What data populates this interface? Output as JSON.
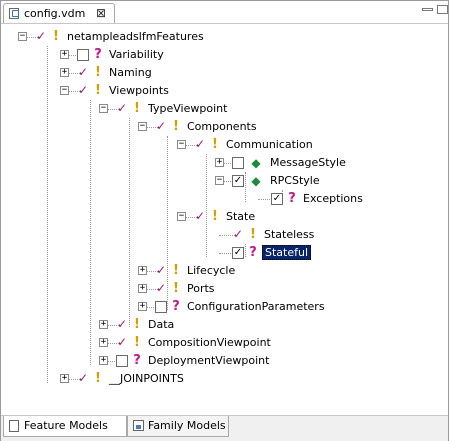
{
  "editor": {
    "tab_title": "config.vdm",
    "close_glyph": "⊠"
  },
  "colors": {
    "selected_bg": "#0a246a",
    "check_color": "#a0157a",
    "excl_color": "#d4a000",
    "quest_color": "#c01a8a",
    "diamond_color": "#1e8a3a"
  },
  "tree": [
    {
      "label": "netampleadslfmFeatures",
      "expander": "−",
      "check": "✓",
      "icon": "!",
      "icon_name": "mandatory-feature-icon"
    },
    {
      "label": "Variability",
      "expander": "+",
      "check": "",
      "icon": "?",
      "icon_name": "optional-feature-icon"
    },
    {
      "label": "Naming",
      "expander": "+",
      "check": "✓",
      "icon": "!",
      "icon_name": "mandatory-feature-icon"
    },
    {
      "label": "Viewpoints",
      "expander": "−",
      "check": "✓",
      "icon": "!",
      "icon_name": "mandatory-feature-icon"
    },
    {
      "label": "TypeViewpoint",
      "expander": "−",
      "check": "✓",
      "icon": "!",
      "icon_name": "mandatory-feature-icon"
    },
    {
      "label": "Components",
      "expander": "−",
      "check": "✓",
      "icon": "!",
      "icon_name": "mandatory-feature-icon"
    },
    {
      "label": "Communication",
      "expander": "−",
      "check": "✓",
      "icon": "!",
      "icon_name": "mandatory-feature-icon"
    },
    {
      "label": "MessageStyle",
      "expander": "+",
      "check": "",
      "icon": "◆",
      "icon_name": "alternative-group-icon"
    },
    {
      "label": "RPCStyle",
      "expander": "−",
      "check": "✓",
      "icon": "◆",
      "icon_name": "alternative-group-icon"
    },
    {
      "label": "Exceptions",
      "expander": "",
      "check": "✓",
      "icon": "?",
      "icon_name": "optional-feature-icon"
    },
    {
      "label": "State",
      "expander": "−",
      "check": "✓",
      "icon": "!",
      "icon_name": "mandatory-feature-icon"
    },
    {
      "label": "Stateless",
      "expander": "",
      "check": "✓",
      "icon": "!",
      "icon_name": "mandatory-feature-icon"
    },
    {
      "label": "Stateful",
      "expander": "",
      "check": "✓",
      "icon": "?",
      "icon_name": "optional-feature-icon"
    },
    {
      "label": "Lifecycle",
      "expander": "+",
      "check": "✓",
      "icon": "!",
      "icon_name": "mandatory-feature-icon"
    },
    {
      "label": "Ports",
      "expander": "+",
      "check": "✓",
      "icon": "!",
      "icon_name": "mandatory-feature-icon"
    },
    {
      "label": "ConfigurationParameters",
      "expander": "+",
      "check": "",
      "icon": "?",
      "icon_name": "optional-feature-icon"
    },
    {
      "label": "Data",
      "expander": "+",
      "check": "✓",
      "icon": "!",
      "icon_name": "mandatory-feature-icon"
    },
    {
      "label": "CompositionViewpoint",
      "expander": "+",
      "check": "✓",
      "icon": "!",
      "icon_name": "mandatory-feature-icon"
    },
    {
      "label": "DeploymentViewpoint",
      "expander": "+",
      "check": "",
      "icon": "?",
      "icon_name": "optional-feature-icon"
    },
    {
      "label": "__JOINPOINTS",
      "expander": "+",
      "check": "✓",
      "icon": "!",
      "icon_name": "mandatory-feature-icon"
    }
  ],
  "bottom_tabs": {
    "feature_models": "Feature Models",
    "family_models": "Family Models"
  }
}
